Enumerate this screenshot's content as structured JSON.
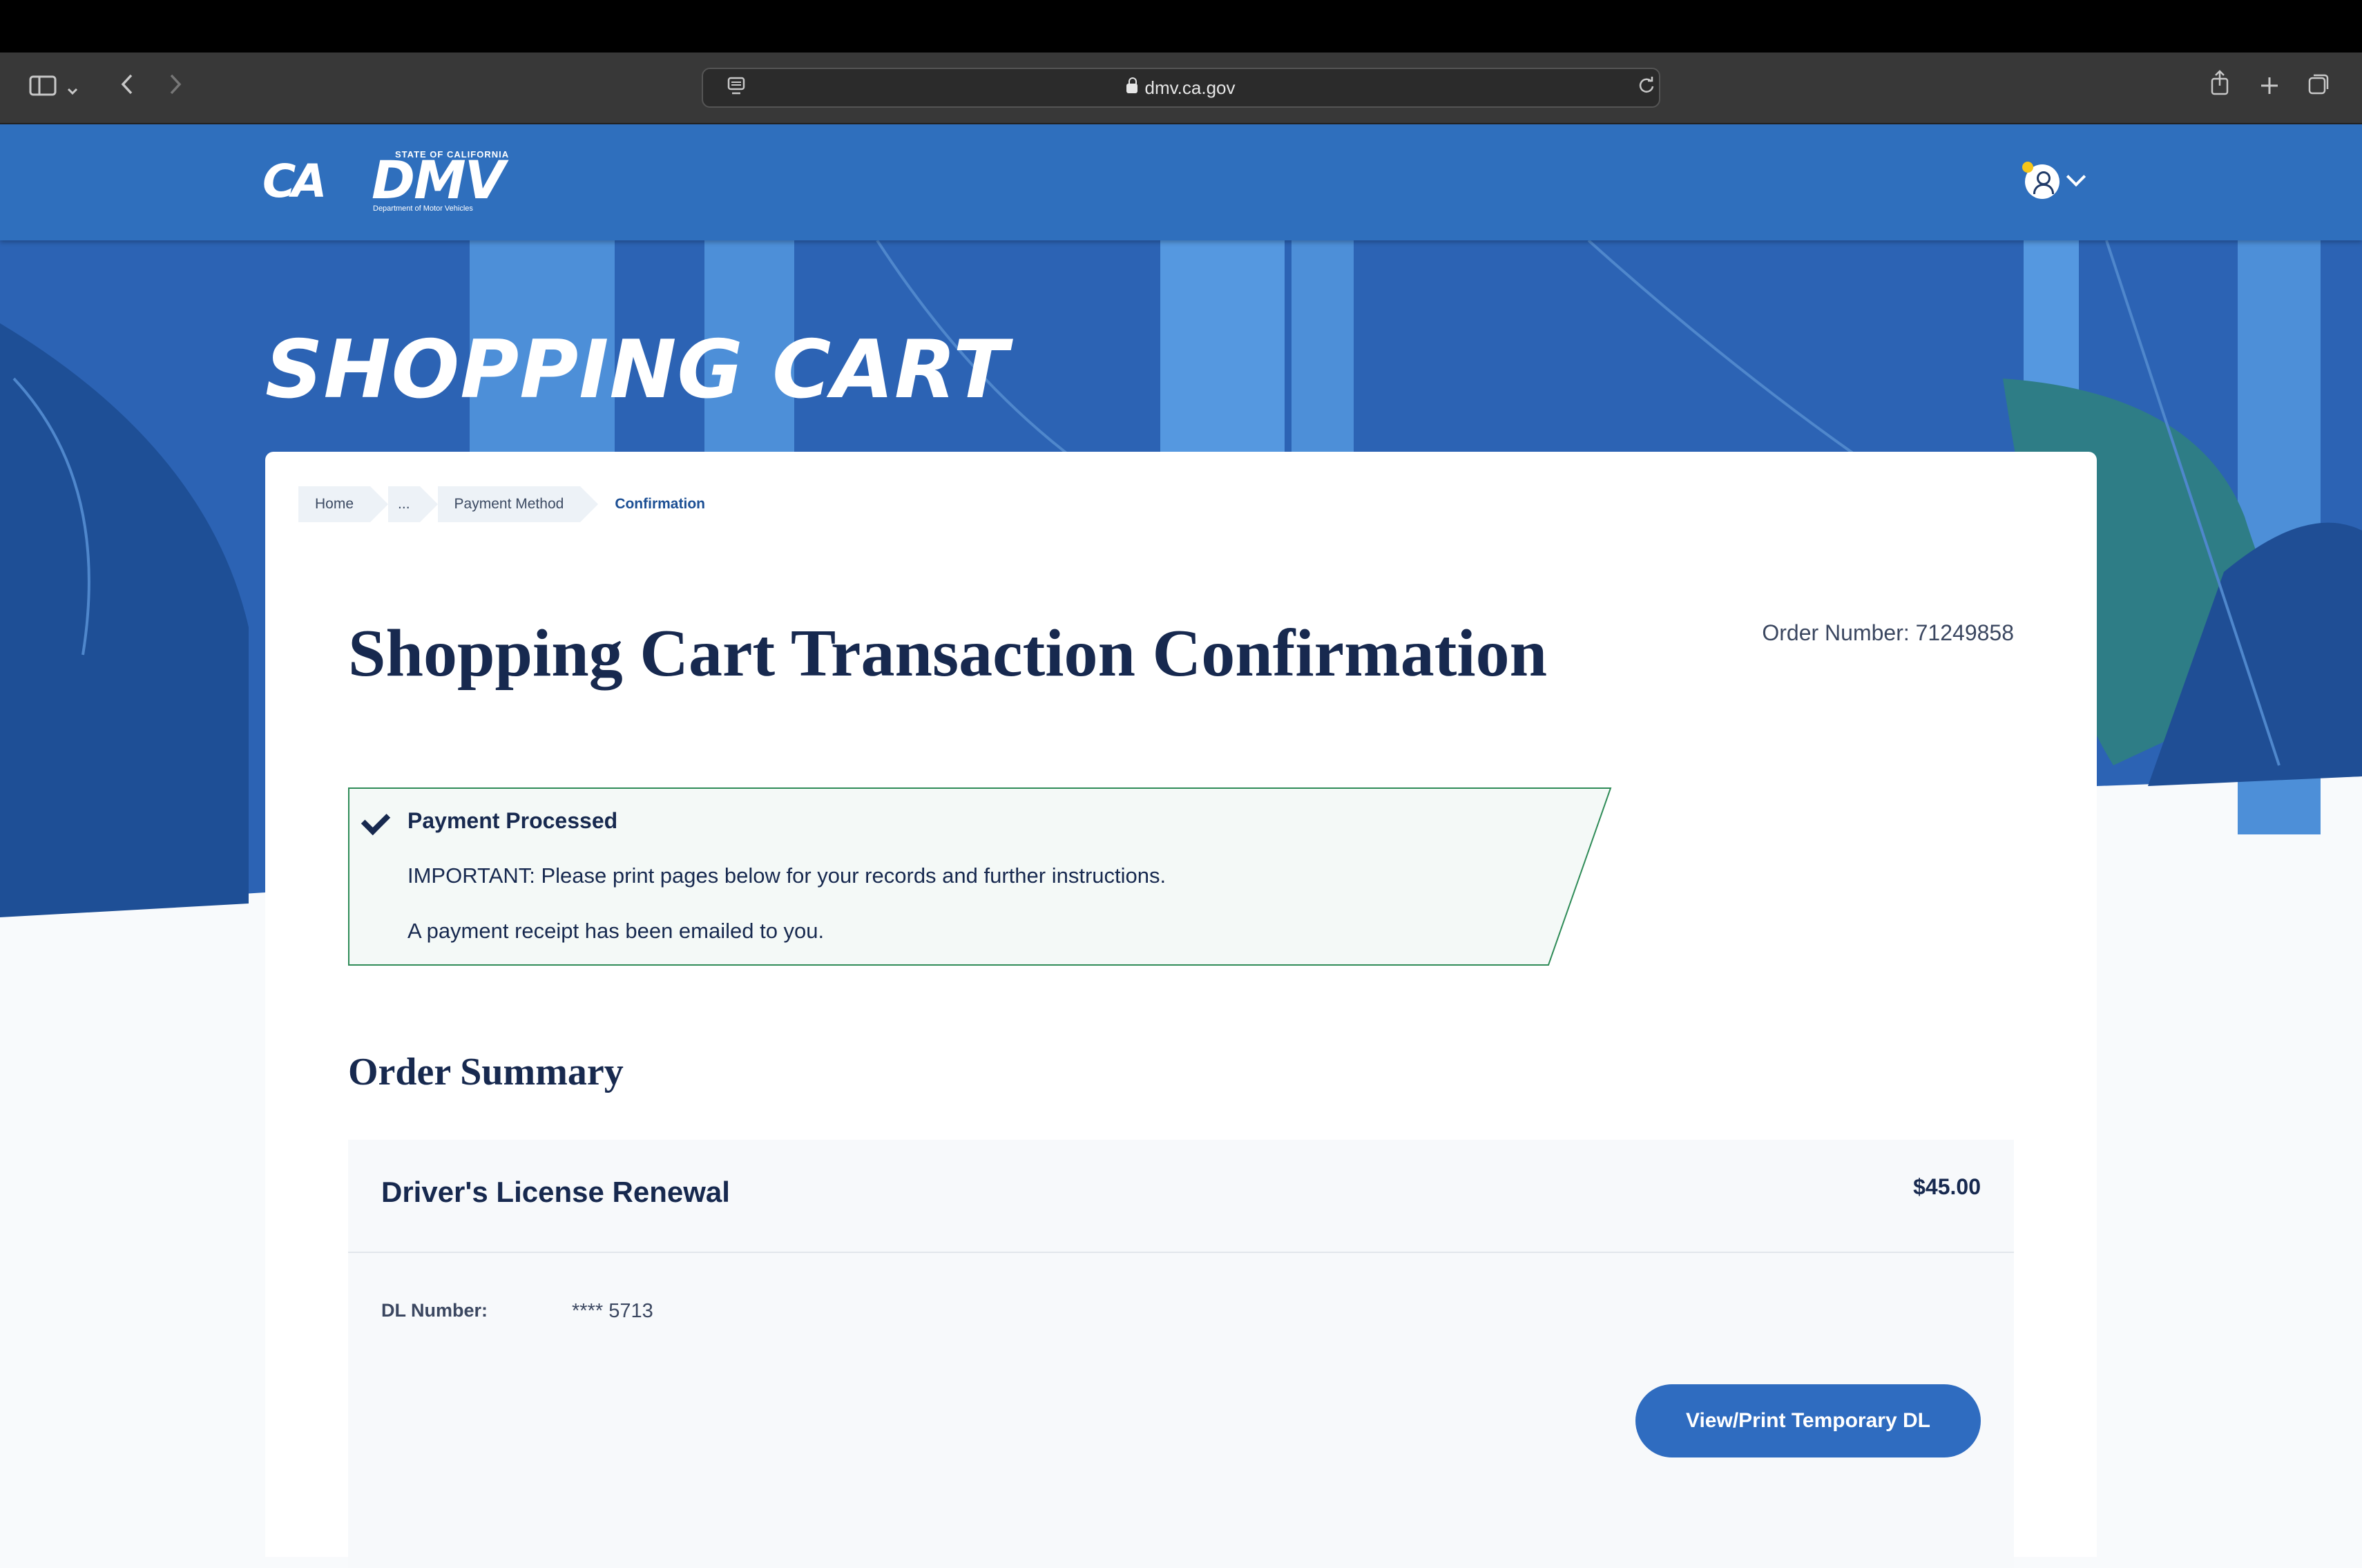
{
  "browser": {
    "url": "dmv.ca.gov",
    "icons": [
      "sidebar-icon",
      "chevron-down-icon",
      "back-icon",
      "forward-icon",
      "reader-icon",
      "reload-icon",
      "share-icon",
      "new-tab-icon",
      "tabs-icon"
    ]
  },
  "header": {
    "ca_logo": "CA",
    "dmv_state": "STATE OF CALIFORNIA",
    "dmv_logo": "DMV",
    "dmv_dept": "Department of Motor Vehicles"
  },
  "hero": {
    "title": "SHOPPING CART"
  },
  "breadcrumbs": [
    "Home",
    "...",
    "Payment Method",
    "Confirmation"
  ],
  "page": {
    "title": "Shopping Cart Transaction Confirmation",
    "order_label": "Order Number:",
    "order_number": "71249858"
  },
  "alert": {
    "title": "Payment Processed",
    "line1": "IMPORTANT: Please print pages below for your records and further instructions.",
    "line2": "A payment receipt has been emailed to you."
  },
  "summary": {
    "title": "Order Summary",
    "item_name": "Driver's License Renewal",
    "item_price": "$45.00",
    "dl_label": "DL Number:",
    "dl_value": "**** 5713",
    "button": "View/Print Temporary DL"
  },
  "colors": {
    "header_blue": "#2f6fbd",
    "navy": "#17294f",
    "alert_green": "#2e8b57"
  }
}
